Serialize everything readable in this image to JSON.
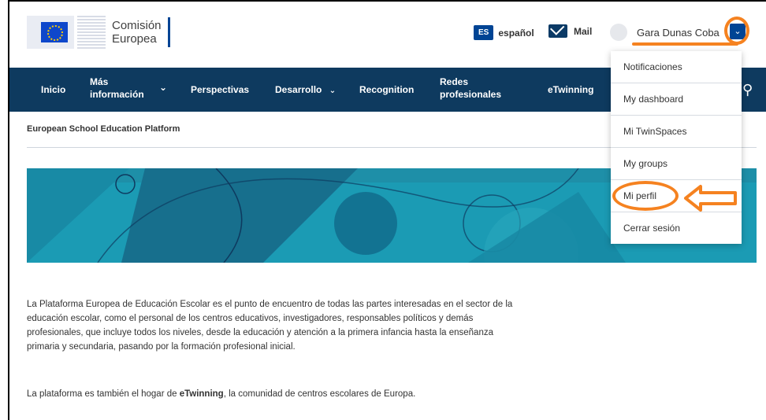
{
  "header": {
    "logo_line1": "Comisión",
    "logo_line2": "Europea",
    "lang_code": "ES",
    "lang_label": "español",
    "mail_label": "Mail",
    "user_name": "Gara Dunas Coba",
    "user_menu_chevron": "⌄"
  },
  "nav": {
    "items": [
      {
        "label": "Inicio"
      },
      {
        "label": "Más información"
      },
      {
        "label": "Perspectivas"
      },
      {
        "label": "Desarrollo"
      },
      {
        "label": "Recognition"
      },
      {
        "label": "Redes profesionales"
      },
      {
        "label": "eTwinning"
      }
    ],
    "chevron": "⌄",
    "search_icon": "search-icon"
  },
  "main": {
    "platform_title": "European School Education Platform",
    "paragraph1": "La Plataforma Europea de Educación Escolar es el punto de encuentro de todas las partes interesadas en el sector de la educación escolar, como el personal de los centros educativos, investigadores, responsables políticos y demás profesionales, que incluye todos los niveles, desde la educación y atención a la primera infancia hasta la enseñanza primaria y secundaria, pasando por la formación profesional inicial.",
    "paragraph2_before": "La plataforma es también el hogar de ",
    "paragraph2_bold": "eTwinning",
    "paragraph2_after": ", la comunidad de centros escolares de Europa."
  },
  "user_menu": {
    "items": [
      {
        "label": "Notificaciones"
      },
      {
        "label": "My dashboard"
      },
      {
        "label": "Mi TwinSpaces"
      },
      {
        "label": "My groups"
      },
      {
        "label": "Mi perfil"
      },
      {
        "label": "Cerrar sesión"
      }
    ]
  },
  "colors": {
    "nav_bg": "#0e3a5f",
    "brand_blue": "#004494",
    "banner_teal": "#1b9bb4",
    "annotation_orange": "#f58220"
  }
}
